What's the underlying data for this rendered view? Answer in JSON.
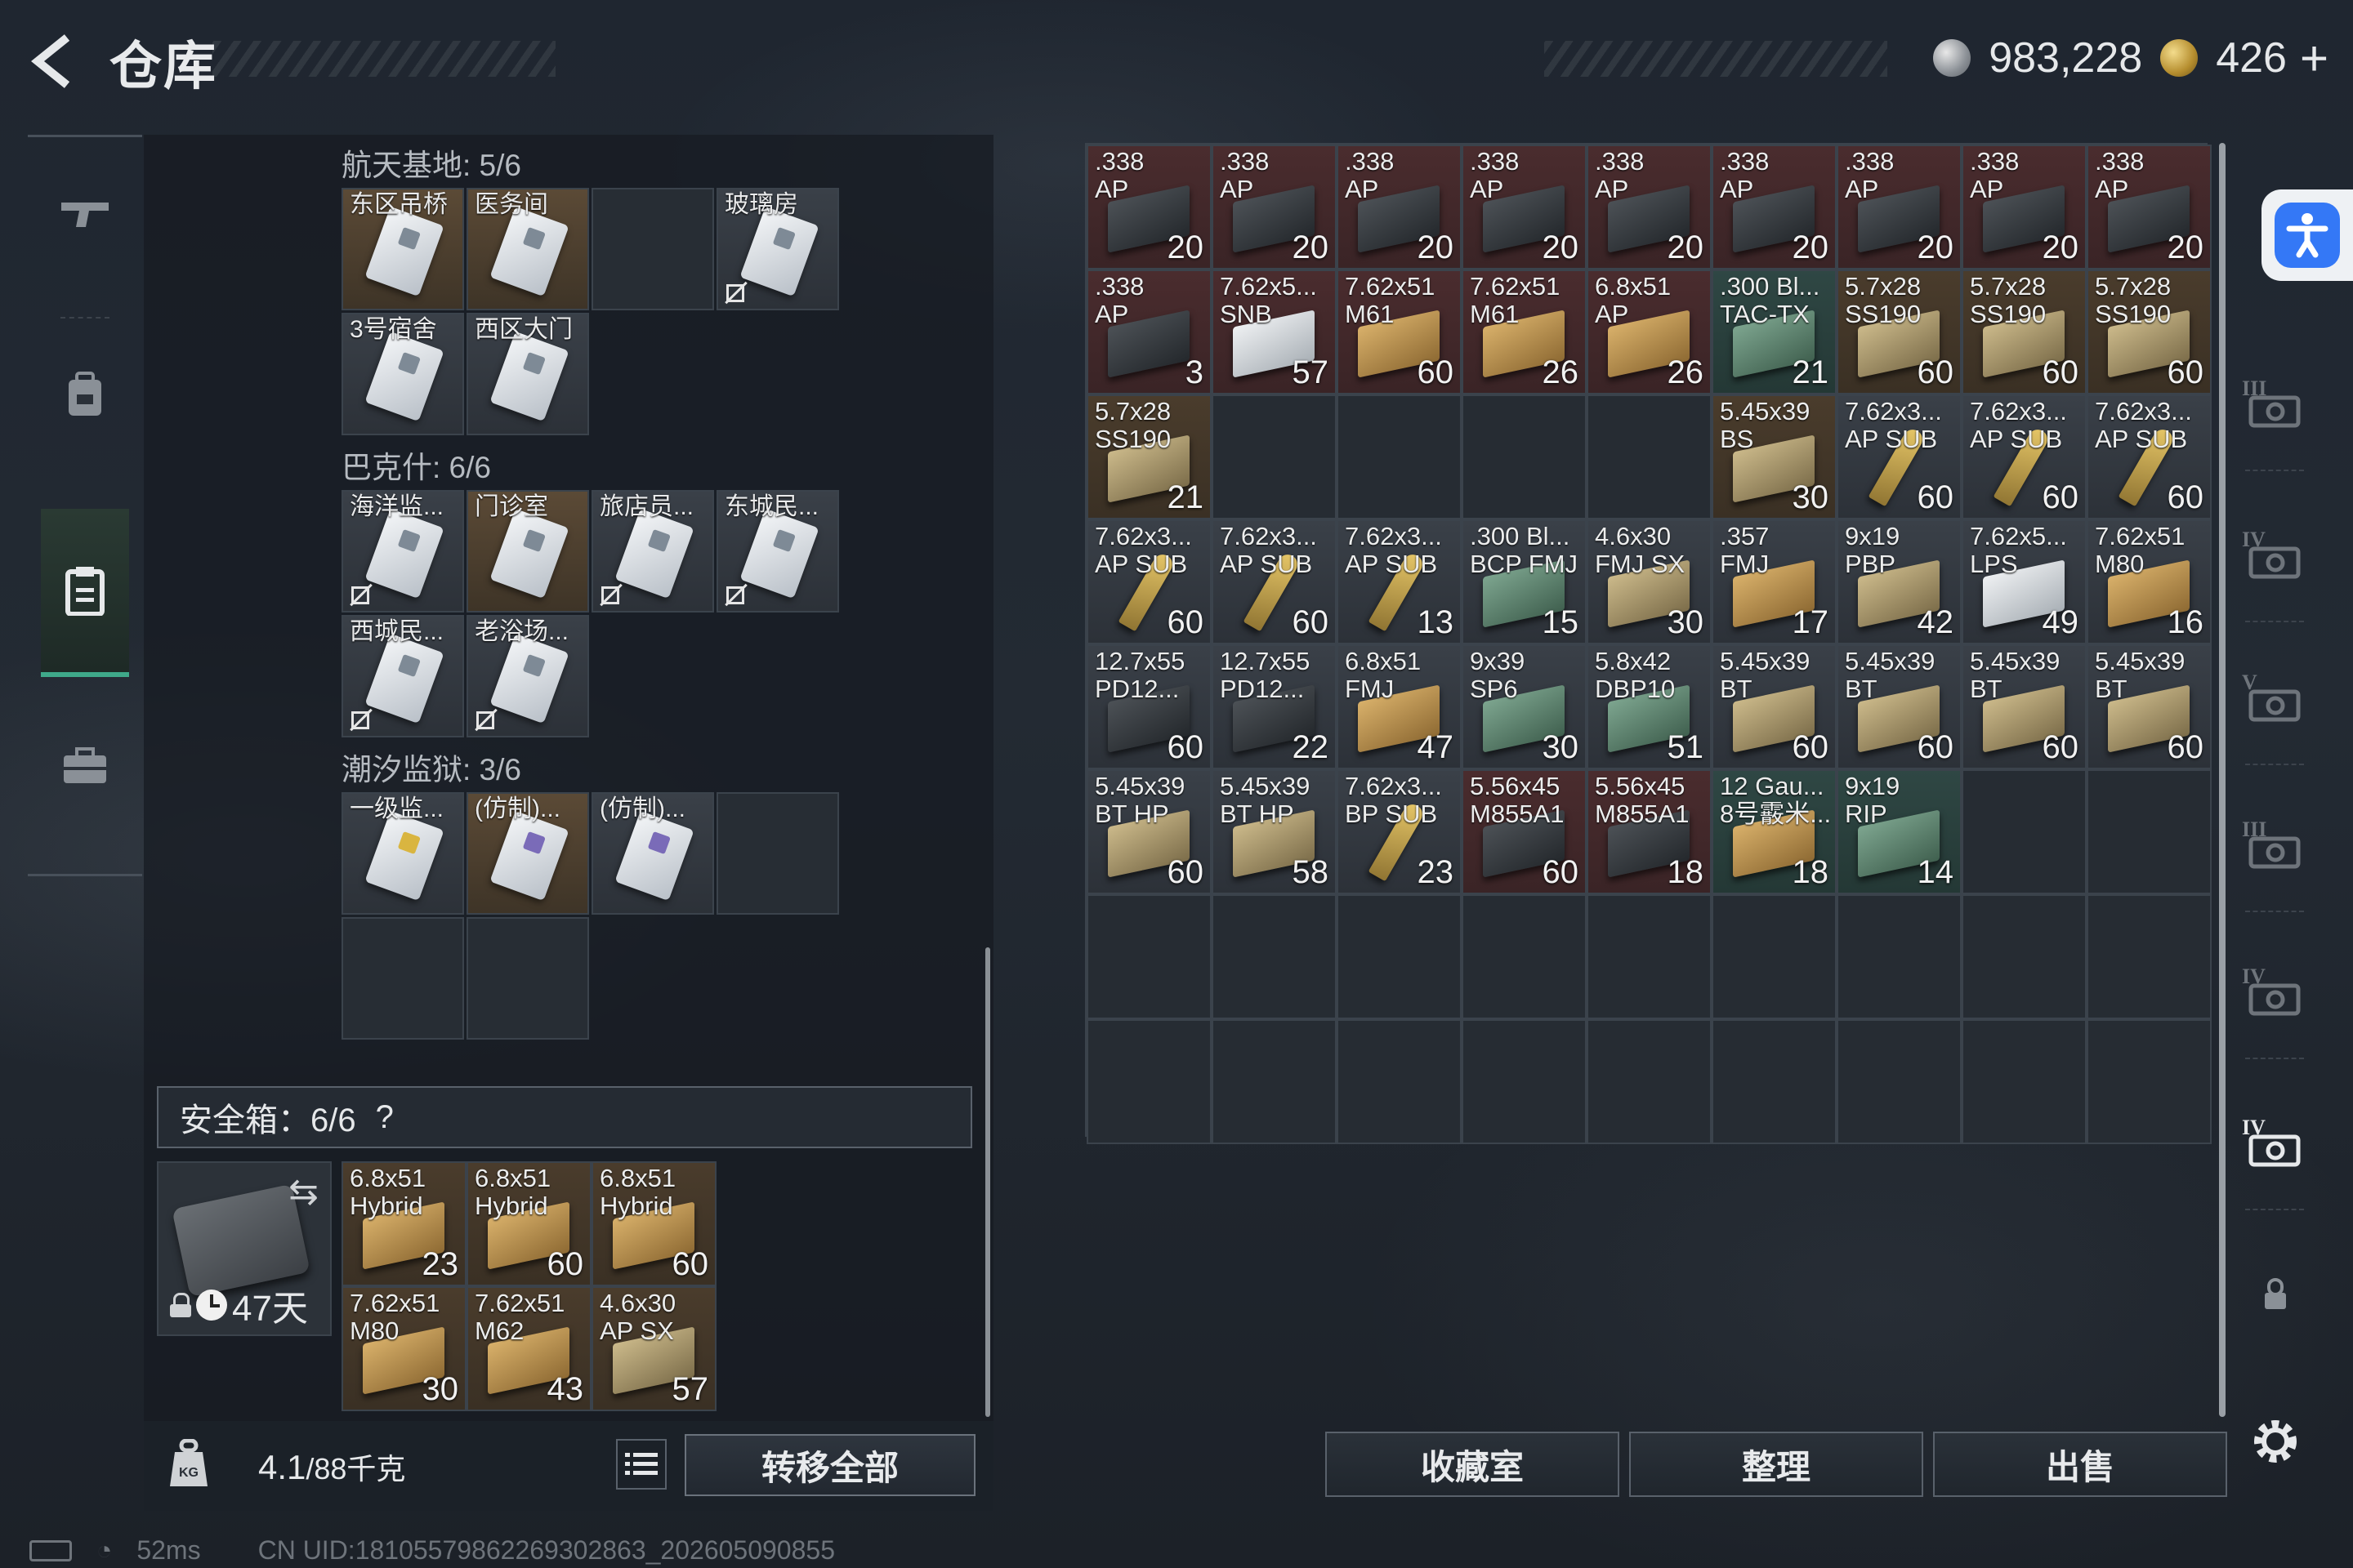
{
  "header": {
    "title": "仓库",
    "silver": "983,228",
    "gold": "426",
    "plus": "+"
  },
  "left_groups": [
    {
      "title": "航天基地: 5/6",
      "cards": [
        {
          "label": "东区吊桥",
          "bg": "brown",
          "icon": "keycard",
          "restricted": false
        },
        {
          "label": "医务间",
          "bg": "brown",
          "icon": "keycard",
          "restricted": false
        },
        {
          "label": "",
          "bg": "empty",
          "icon": "none",
          "restricted": false
        },
        {
          "label": "玻璃房",
          "bg": "grey",
          "icon": "keycard",
          "restricted": true
        },
        {
          "label": "3号宿舍",
          "bg": "grey",
          "icon": "keycard",
          "restricted": false
        },
        {
          "label": "西区大门",
          "bg": "grey",
          "icon": "keycard",
          "restricted": false
        }
      ]
    },
    {
      "title": "巴克什: 6/6",
      "cards": [
        {
          "label": "海洋监...",
          "bg": "grey",
          "icon": "keycard",
          "restricted": true
        },
        {
          "label": "门诊室",
          "bg": "brown",
          "icon": "keycard",
          "restricted": false
        },
        {
          "label": "旅店员...",
          "bg": "grey",
          "icon": "keycard",
          "restricted": true
        },
        {
          "label": "东城民...",
          "bg": "grey",
          "icon": "keycard",
          "restricted": true
        },
        {
          "label": "西城民...",
          "bg": "grey",
          "icon": "keycard",
          "restricted": true
        },
        {
          "label": "老浴场...",
          "bg": "grey",
          "icon": "keycard",
          "restricted": true
        }
      ]
    },
    {
      "title": "潮汐监狱: 3/6",
      "cards": [
        {
          "label": "一级监...",
          "bg": "grey",
          "icon": "keycard-yellow",
          "restricted": false
        },
        {
          "label": "(仿制)...",
          "bg": "brown",
          "icon": "keycard-purple",
          "restricted": false
        },
        {
          "label": "(仿制)...",
          "bg": "grey",
          "icon": "keycard-purple",
          "restricted": false
        },
        {
          "label": "",
          "bg": "empty",
          "icon": "none",
          "restricted": false
        },
        {
          "label": "",
          "bg": "empty",
          "icon": "none",
          "restricted": false
        },
        {
          "label": "",
          "bg": "empty",
          "icon": "none",
          "restricted": false
        }
      ]
    }
  ],
  "safe_box": {
    "title": "安全箱：6/6",
    "help": "?",
    "days": "47天",
    "items": [
      {
        "l1": "6.8x51",
        "l2": "Hybrid",
        "count": "23",
        "bg": "brown",
        "box": "tan"
      },
      {
        "l1": "6.8x51",
        "l2": "Hybrid",
        "count": "60",
        "bg": "brown",
        "box": "tan"
      },
      {
        "l1": "6.8x51",
        "l2": "Hybrid",
        "count": "60",
        "bg": "brown",
        "box": "tan"
      },
      {
        "l1": "7.62x51",
        "l2": "M80",
        "count": "30",
        "bg": "brown",
        "box": "tan"
      },
      {
        "l1": "7.62x51",
        "l2": "M62",
        "count": "43",
        "bg": "brown",
        "box": "tan"
      },
      {
        "l1": "4.6x30",
        "l2": "AP SX",
        "count": "57",
        "bg": "brown",
        "box": "olive"
      }
    ]
  },
  "weight": {
    "current": "4.1",
    "max": "/88千克"
  },
  "buttons": {
    "transfer_all": "转移全部",
    "collection": "收藏室",
    "sort": "整理",
    "sell": "出售"
  },
  "stash_items": [
    {
      "l1": ".338",
      "l2": "AP",
      "count": "20",
      "bg": "red",
      "box": "dark"
    },
    {
      "l1": ".338",
      "l2": "AP",
      "count": "20",
      "bg": "red",
      "box": "dark"
    },
    {
      "l1": ".338",
      "l2": "AP",
      "count": "20",
      "bg": "red",
      "box": "dark"
    },
    {
      "l1": ".338",
      "l2": "AP",
      "count": "20",
      "bg": "red",
      "box": "dark"
    },
    {
      "l1": ".338",
      "l2": "AP",
      "count": "20",
      "bg": "red",
      "box": "dark"
    },
    {
      "l1": ".338",
      "l2": "AP",
      "count": "20",
      "bg": "red",
      "box": "dark"
    },
    {
      "l1": ".338",
      "l2": "AP",
      "count": "20",
      "bg": "red",
      "box": "dark"
    },
    {
      "l1": ".338",
      "l2": "AP",
      "count": "20",
      "bg": "red",
      "box": "dark"
    },
    {
      "l1": ".338",
      "l2": "AP",
      "count": "20",
      "bg": "red",
      "box": "dark"
    },
    {
      "l1": ".338",
      "l2": "AP",
      "count": "3",
      "bg": "red",
      "box": "dark"
    },
    {
      "l1": "7.62x5...",
      "l2": "SNB",
      "count": "57",
      "bg": "red",
      "box": "white"
    },
    {
      "l1": "7.62x51",
      "l2": "M61",
      "count": "60",
      "bg": "red",
      "box": "tan"
    },
    {
      "l1": "7.62x51",
      "l2": "M61",
      "count": "26",
      "bg": "red",
      "box": "tan"
    },
    {
      "l1": "6.8x51",
      "l2": "AP",
      "count": "26",
      "bg": "red",
      "box": "tan"
    },
    {
      "l1": ".300 Bl...",
      "l2": "TAC-TX",
      "count": "21",
      "bg": "teal",
      "box": "green"
    },
    {
      "l1": "5.7x28",
      "l2": "SS190",
      "count": "60",
      "bg": "brown",
      "box": "olive"
    },
    {
      "l1": "5.7x28",
      "l2": "SS190",
      "count": "60",
      "bg": "brown",
      "box": "olive"
    },
    {
      "l1": "5.7x28",
      "l2": "SS190",
      "count": "60",
      "bg": "brown",
      "box": "olive"
    },
    {
      "l1": "5.7x28",
      "l2": "SS190",
      "count": "21",
      "bg": "brown",
      "box": "olive"
    },
    {
      "l1": "",
      "l2": "",
      "count": "",
      "bg": "empty",
      "box": "none"
    },
    {
      "l1": "",
      "l2": "",
      "count": "",
      "bg": "empty",
      "box": "none"
    },
    {
      "l1": "",
      "l2": "",
      "count": "",
      "bg": "empty",
      "box": "none"
    },
    {
      "l1": "",
      "l2": "",
      "count": "",
      "bg": "empty",
      "box": "none"
    },
    {
      "l1": "5.45x39",
      "l2": "BS",
      "count": "30",
      "bg": "brown",
      "box": "olive"
    },
    {
      "l1": "7.62x3...",
      "l2": "AP SUB",
      "count": "60",
      "bg": "grey",
      "box": "bullet"
    },
    {
      "l1": "7.62x3...",
      "l2": "AP SUB",
      "count": "60",
      "bg": "grey",
      "box": "bullet"
    },
    {
      "l1": "7.62x3...",
      "l2": "AP SUB",
      "count": "60",
      "bg": "grey",
      "box": "bullet"
    },
    {
      "l1": "7.62x3...",
      "l2": "AP SUB",
      "count": "60",
      "bg": "grey",
      "box": "bullet"
    },
    {
      "l1": "7.62x3...",
      "l2": "AP SUB",
      "count": "60",
      "bg": "grey",
      "box": "bullet"
    },
    {
      "l1": "7.62x3...",
      "l2": "AP SUB",
      "count": "13",
      "bg": "grey",
      "box": "bullet"
    },
    {
      "l1": ".300 Bl...",
      "l2": "BCP FMJ",
      "count": "15",
      "bg": "grey",
      "box": "green"
    },
    {
      "l1": "4.6x30",
      "l2": "FMJ SX",
      "count": "30",
      "bg": "grey",
      "box": "olive"
    },
    {
      "l1": ".357",
      "l2": "FMJ",
      "count": "17",
      "bg": "grey",
      "box": "tan"
    },
    {
      "l1": "9x19",
      "l2": "PBP",
      "count": "42",
      "bg": "grey",
      "box": "olive"
    },
    {
      "l1": "7.62x5...",
      "l2": "LPS",
      "count": "49",
      "bg": "grey",
      "box": "white"
    },
    {
      "l1": "7.62x51",
      "l2": "M80",
      "count": "16",
      "bg": "grey",
      "box": "tan"
    },
    {
      "l1": "12.7x55",
      "l2": "PD12...",
      "count": "60",
      "bg": "grey",
      "box": "dark"
    },
    {
      "l1": "12.7x55",
      "l2": "PD12...",
      "count": "22",
      "bg": "grey",
      "box": "dark"
    },
    {
      "l1": "6.8x51",
      "l2": "FMJ",
      "count": "47",
      "bg": "grey",
      "box": "tan"
    },
    {
      "l1": "9x39",
      "l2": "SP6",
      "count": "30",
      "bg": "grey",
      "box": "green"
    },
    {
      "l1": "5.8x42",
      "l2": "DBP10",
      "count": "51",
      "bg": "grey",
      "box": "green"
    },
    {
      "l1": "5.45x39",
      "l2": "BT",
      "count": "60",
      "bg": "grey",
      "box": "olive"
    },
    {
      "l1": "5.45x39",
      "l2": "BT",
      "count": "60",
      "bg": "grey",
      "box": "olive"
    },
    {
      "l1": "5.45x39",
      "l2": "BT",
      "count": "60",
      "bg": "grey",
      "box": "olive"
    },
    {
      "l1": "5.45x39",
      "l2": "BT",
      "count": "60",
      "bg": "grey",
      "box": "olive"
    },
    {
      "l1": "5.45x39",
      "l2": "BT HP",
      "count": "60",
      "bg": "grey",
      "box": "olive"
    },
    {
      "l1": "5.45x39",
      "l2": "BT HP",
      "count": "58",
      "bg": "grey",
      "box": "olive"
    },
    {
      "l1": "7.62x3...",
      "l2": "BP SUB",
      "count": "23",
      "bg": "grey",
      "box": "bullet"
    },
    {
      "l1": "5.56x45",
      "l2": "M855A1",
      "count": "60",
      "bg": "red",
      "box": "dark"
    },
    {
      "l1": "5.56x45",
      "l2": "M855A1",
      "count": "18",
      "bg": "red",
      "box": "dark"
    },
    {
      "l1": "12 Gau...",
      "l2": "8号霰米...",
      "count": "18",
      "bg": "teal",
      "box": "tan"
    },
    {
      "l1": "9x19",
      "l2": "RIP",
      "count": "14",
      "bg": "teal",
      "box": "green"
    }
  ],
  "sidebar": {
    "left": [
      {
        "name": "weapon",
        "icon": "gun-icon"
      },
      {
        "name": "equipment",
        "icon": "backpack-icon"
      },
      {
        "name": "stash",
        "icon": "clipboard-icon"
      },
      {
        "name": "case",
        "icon": "briefcase-icon"
      }
    ],
    "right_labels": [
      "III",
      "IV",
      "V",
      "III",
      "IV",
      "IV"
    ]
  },
  "status": {
    "ping": "52ms",
    "uid": "CN UID:18105579862269302863_202605090855"
  }
}
